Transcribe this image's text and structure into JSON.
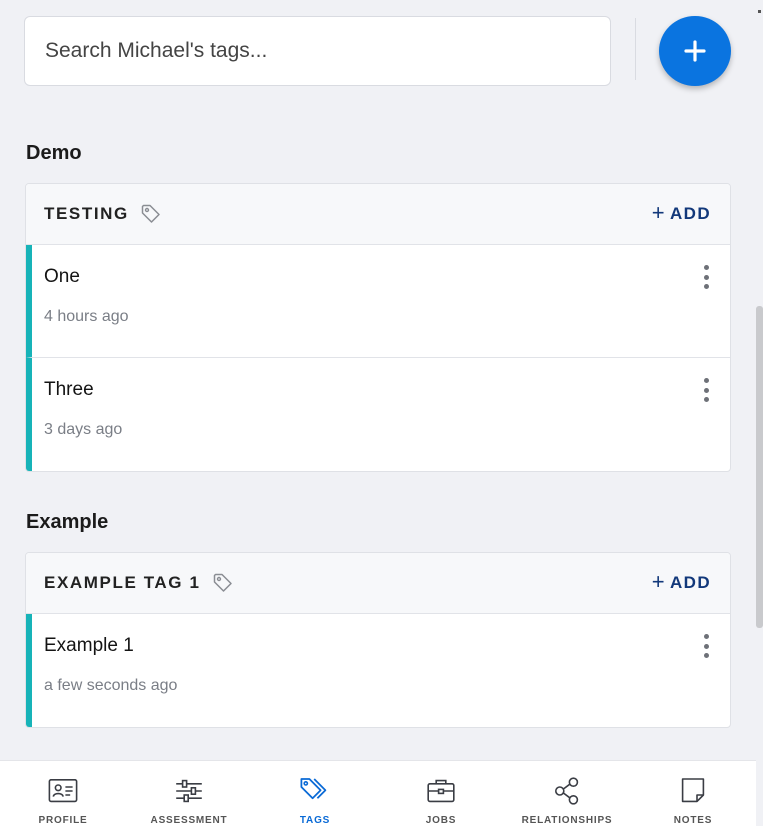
{
  "search": {
    "placeholder": "Search Michael's tags..."
  },
  "fab": {
    "icon": "plus-icon",
    "color": "#0a74e0"
  },
  "groups": [
    {
      "title": "Demo",
      "card": {
        "tag": "TESTING",
        "add_label": "ADD",
        "items": [
          {
            "title": "One",
            "time": "4 hours ago"
          },
          {
            "title": "Three",
            "time": "3 days ago"
          }
        ]
      }
    },
    {
      "title": "Example",
      "card": {
        "tag": "EXAMPLE TAG 1",
        "add_label": "ADD",
        "items": [
          {
            "title": "Example 1",
            "time": "a few seconds ago"
          }
        ]
      }
    }
  ],
  "accent_color": "#17b3b8",
  "nav": {
    "active": "tags",
    "items": [
      {
        "label": "PROFILE",
        "icon": "id-card-icon"
      },
      {
        "label": "ASSESSMENT",
        "icon": "sliders-icon"
      },
      {
        "label": "TAGS",
        "icon": "tags-icon"
      },
      {
        "label": "JOBS",
        "icon": "briefcase-icon"
      },
      {
        "label": "RELATIONSHIPS",
        "icon": "share-icon"
      },
      {
        "label": "NOTES",
        "icon": "note-icon"
      }
    ]
  }
}
